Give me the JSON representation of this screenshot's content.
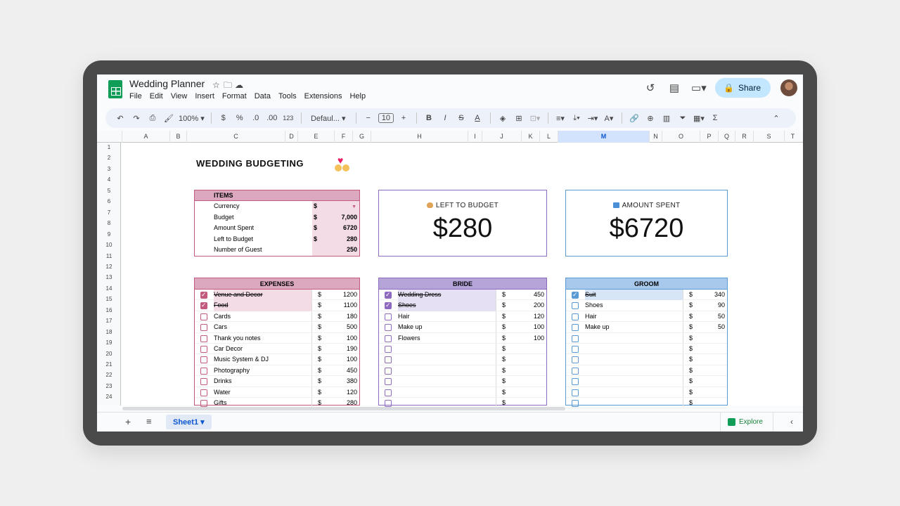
{
  "document": {
    "title": "Wedding Planner"
  },
  "menu": [
    "File",
    "Edit",
    "View",
    "Insert",
    "Format",
    "Data",
    "Tools",
    "Extensions",
    "Help"
  ],
  "header_actions": {
    "share_label": "Share"
  },
  "toolbar": {
    "zoom": "100%",
    "currency": "$",
    "percent": "%",
    "dec_dec": ".0",
    "inc_dec": ".00",
    "more_formats": "123",
    "font": "Defaul...",
    "font_size": "10"
  },
  "columns": [
    "A",
    "B",
    "C",
    "D",
    "E",
    "F",
    "G",
    "H",
    "I",
    "J",
    "K",
    "L",
    "M",
    "N",
    "O",
    "P",
    "Q",
    "R",
    "S",
    "T"
  ],
  "selected_column": "M",
  "rows": [
    "1",
    "2",
    "3",
    "4",
    "5",
    "6",
    "7",
    "8",
    "9",
    "10",
    "11",
    "12",
    "13",
    "14",
    "15",
    "16",
    "17",
    "18",
    "19",
    "20",
    "21",
    "22",
    "23",
    "24"
  ],
  "sheet": {
    "title": "WEDDING BUDGETING",
    "items": {
      "header": "ITEMS",
      "rows": [
        {
          "label": "Currency",
          "cur": "$",
          "value": ""
        },
        {
          "label": "Budget",
          "cur": "$",
          "value": "7,000"
        },
        {
          "label": "Amount Spent",
          "cur": "$",
          "value": "6720"
        },
        {
          "label": "Left to Budget",
          "cur": "$",
          "value": "280"
        },
        {
          "label": "Number of Guest",
          "cur": "",
          "value": "250"
        }
      ]
    },
    "left_card": {
      "caption": "LEFT TO BUDGET",
      "value": "$280"
    },
    "spent_card": {
      "caption": "AMOUNT SPENT",
      "value": "$6720"
    },
    "expenses": {
      "header": "EXPENSES",
      "rows": [
        {
          "name": "Venue and Decor",
          "checked": true,
          "cur": "$",
          "amount": "1200"
        },
        {
          "name": "Food",
          "checked": true,
          "cur": "$",
          "amount": "1100"
        },
        {
          "name": "Cards",
          "checked": false,
          "cur": "$",
          "amount": "180"
        },
        {
          "name": "Cars",
          "checked": false,
          "cur": "$",
          "amount": "500"
        },
        {
          "name": "Thank you notes",
          "checked": false,
          "cur": "$",
          "amount": "100"
        },
        {
          "name": "Car Decor",
          "checked": false,
          "cur": "$",
          "amount": "190"
        },
        {
          "name": "Music System & DJ",
          "checked": false,
          "cur": "$",
          "amount": "100"
        },
        {
          "name": "Photography",
          "checked": false,
          "cur": "$",
          "amount": "450"
        },
        {
          "name": "Drinks",
          "checked": false,
          "cur": "$",
          "amount": "380"
        },
        {
          "name": "Water",
          "checked": false,
          "cur": "$",
          "amount": "120"
        },
        {
          "name": "Gifts",
          "checked": false,
          "cur": "$",
          "amount": "280"
        }
      ]
    },
    "bride": {
      "header": "BRIDE",
      "rows": [
        {
          "name": "Wedding Dress",
          "checked": true,
          "cur": "$",
          "amount": "450"
        },
        {
          "name": "Shoes",
          "checked": true,
          "cur": "$",
          "amount": "200"
        },
        {
          "name": "Hair",
          "checked": false,
          "cur": "$",
          "amount": "120"
        },
        {
          "name": "Make up",
          "checked": false,
          "cur": "$",
          "amount": "100"
        },
        {
          "name": "Flowers",
          "checked": false,
          "cur": "$",
          "amount": "100"
        },
        {
          "name": "",
          "checked": false,
          "cur": "$",
          "amount": ""
        },
        {
          "name": "",
          "checked": false,
          "cur": "$",
          "amount": ""
        },
        {
          "name": "",
          "checked": false,
          "cur": "$",
          "amount": ""
        },
        {
          "name": "",
          "checked": false,
          "cur": "$",
          "amount": ""
        },
        {
          "name": "",
          "checked": false,
          "cur": "$",
          "amount": ""
        },
        {
          "name": "",
          "checked": false,
          "cur": "$",
          "amount": ""
        }
      ]
    },
    "groom": {
      "header": "GROOM",
      "rows": [
        {
          "name": "Suit",
          "checked": true,
          "cur": "$",
          "amount": "340"
        },
        {
          "name": "Shoes",
          "checked": false,
          "cur": "$",
          "amount": "90"
        },
        {
          "name": "Hair",
          "checked": false,
          "cur": "$",
          "amount": "50"
        },
        {
          "name": "Make up",
          "checked": false,
          "cur": "$",
          "amount": "50"
        },
        {
          "name": "",
          "checked": false,
          "cur": "$",
          "amount": ""
        },
        {
          "name": "",
          "checked": false,
          "cur": "$",
          "amount": ""
        },
        {
          "name": "",
          "checked": false,
          "cur": "$",
          "amount": ""
        },
        {
          "name": "",
          "checked": false,
          "cur": "$",
          "amount": ""
        },
        {
          "name": "",
          "checked": false,
          "cur": "$",
          "amount": ""
        },
        {
          "name": "",
          "checked": false,
          "cur": "$",
          "amount": ""
        },
        {
          "name": "",
          "checked": false,
          "cur": "$",
          "amount": ""
        }
      ]
    }
  },
  "colors": {
    "expenses_accent": "#c45a7d",
    "expenses_header": "#dca8bf",
    "expenses_fill": "#f4dce7",
    "bride_accent": "#8e6bbf",
    "bride_header": "#b4a4d8",
    "bride_fill": "#e6e0f4",
    "groom_accent": "#5b9bd5",
    "groom_header": "#a9c9ec",
    "groom_fill": "#d6e6f7"
  },
  "footer": {
    "sheet_tab": "Sheet1",
    "explore_label": "Explore"
  }
}
